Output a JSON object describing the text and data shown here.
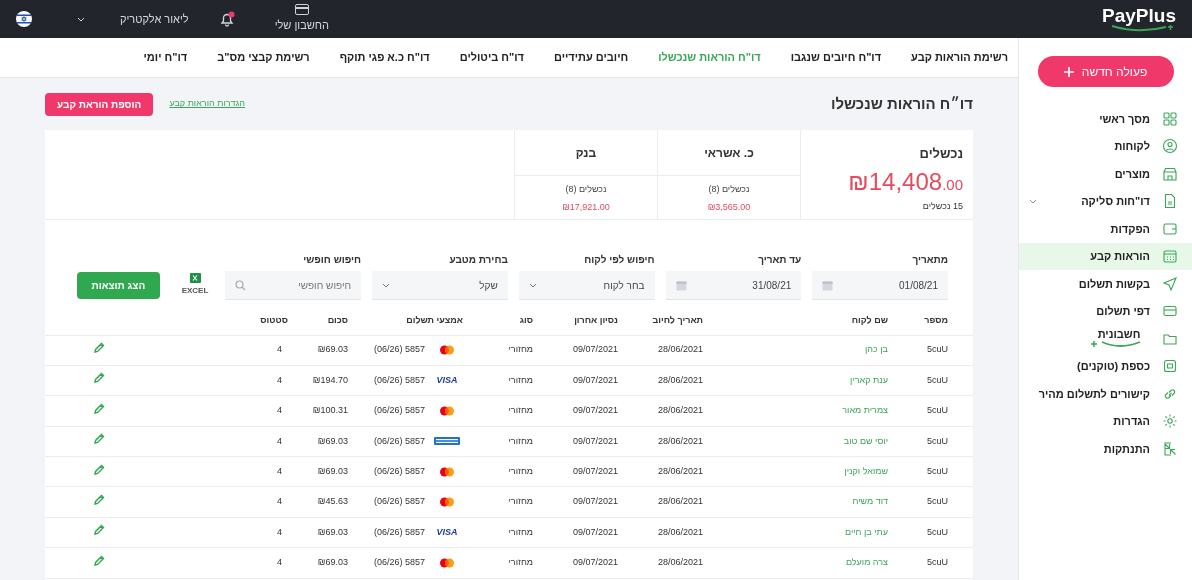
{
  "topbar": {
    "logo": "PayPlus",
    "account": "החשבון שלי",
    "notifications": {
      "unread": true
    },
    "user": "ליאור אלקטריק"
  },
  "sidebar": {
    "new_button": "פעולה חדשה",
    "items": [
      {
        "label": "מסך ראשי",
        "selected": false
      },
      {
        "label": "לקוחות",
        "selected": false
      },
      {
        "label": "מוצרים",
        "selected": false
      },
      {
        "label": "דו\"חות סליקה",
        "selected": false,
        "expandable": true
      },
      {
        "label": "הפקדות",
        "selected": false
      },
      {
        "label": "הוראות קבע",
        "selected": true
      },
      {
        "label": "בקשות תשלום",
        "selected": false
      },
      {
        "label": "דפי תשלום",
        "selected": false
      },
      {
        "label": "חשבונית",
        "selected": false,
        "kind": "logo"
      },
      {
        "label": "כספת (טוקנים)",
        "selected": false
      },
      {
        "label": "קישורים לתשלום מהיר",
        "selected": false
      },
      {
        "label": "הגדרות",
        "selected": false
      },
      {
        "label": "התנתקות",
        "selected": false
      }
    ]
  },
  "tabs": [
    {
      "label": "רשימת הוראות קבע",
      "selected": false
    },
    {
      "label": "דו\"ח חיובים שנגבו",
      "selected": false
    },
    {
      "label": "דו\"ח הוראות שנכשלו",
      "selected": true
    },
    {
      "label": "חיובים עתידיים",
      "selected": false
    },
    {
      "label": "דו\"ח ביטולים",
      "selected": false
    },
    {
      "label": "דו\"ח כ.א פגי תוקף",
      "selected": false
    },
    {
      "label": "רשימת קבצי מס\"ב",
      "selected": false
    },
    {
      "label": "דו\"ח יומי",
      "selected": false
    }
  ],
  "page_title": "דו״ח הוראות שנכשלו",
  "settings_link": "הגדרות הוראות קבע",
  "add_button": "הוספת הוראת קבע",
  "summary": {
    "title": "נכשלים",
    "amount": "₪14,408",
    "decimals": ".00",
    "count": "15 נכשלים",
    "columns": [
      {
        "title": "כ. אשראי",
        "subtitle": "נכשלים (8)",
        "amount": "₪3,565.00"
      },
      {
        "title": "בנק",
        "subtitle": "נכשלים (8)",
        "amount": "₪17,921.00"
      }
    ]
  },
  "filters": [
    {
      "kind": "date",
      "label": "מתאריך",
      "value": "01/08/21"
    },
    {
      "kind": "date",
      "label": "עד תאריך",
      "value": "31/08/21"
    },
    {
      "kind": "select",
      "label": "חיפוש לפי לקוח",
      "value": "בחר לקוח"
    },
    {
      "kind": "select",
      "label": "בחירת מטבע",
      "value": "שקל"
    },
    {
      "kind": "search",
      "label": "חיפוש חופשי",
      "placeholder": "חיפוש חופשי"
    }
  ],
  "excel_label": "EXCEL",
  "show_button": "הצג תוצאות",
  "table": {
    "columns": [
      "מספר",
      "שם לקוח",
      "תאריך לחיוב",
      "נסיון אחרון",
      "סוג",
      "אמצעי תשלום",
      "סכום",
      "סטטוס"
    ],
    "rows": [
      {
        "number": "5cuU",
        "name": "בן כהן",
        "charge_date": "28/06/2021",
        "last_attempt": "09/07/2021",
        "type": "מחזורי",
        "card": {
          "kind": "mastercard"
        },
        "payment": "(06/26) 5857",
        "amount": "₪69.03",
        "status": "4"
      },
      {
        "number": "5cuU",
        "name": "ענת קארין",
        "charge_date": "28/06/2021",
        "last_attempt": "09/07/2021",
        "type": "מחזורי",
        "card": {
          "kind": "visa",
          "mark": "VISA"
        },
        "payment": "(06/26) 5857",
        "amount": "₪194.70",
        "status": "4"
      },
      {
        "number": "5cuU",
        "name": "צמרית מאור",
        "charge_date": "28/06/2021",
        "last_attempt": "09/07/2021",
        "type": "מחזורי",
        "card": {
          "kind": "mastercard"
        },
        "payment": "(06/26) 5857",
        "amount": "₪100.31",
        "status": "4"
      },
      {
        "number": "5cuU",
        "name": "יוסי שם טוב",
        "charge_date": "28/06/2021",
        "last_attempt": "09/07/2021",
        "type": "מחזורי",
        "card": {
          "kind": "amex"
        },
        "payment": "(06/26) 5857",
        "amount": "₪69.03",
        "status": "4"
      },
      {
        "number": "5cuU",
        "name": "שמואל וקנין",
        "charge_date": "28/06/2021",
        "last_attempt": "09/07/2021",
        "type": "מחזורי",
        "card": {
          "kind": "mastercard"
        },
        "payment": "(06/26) 5857",
        "amount": "₪69.03",
        "status": "4"
      },
      {
        "number": "5cuU",
        "name": "דוד משיח",
        "charge_date": "28/06/2021",
        "last_attempt": "09/07/2021",
        "type": "מחזורי",
        "card": {
          "kind": "mastercard"
        },
        "payment": "(06/26) 5857",
        "amount": "₪45.63",
        "status": "4"
      },
      {
        "number": "5cuU",
        "name": "עתי בן חיים",
        "charge_date": "28/06/2021",
        "last_attempt": "09/07/2021",
        "type": "מחזורי",
        "card": {
          "kind": "visa",
          "mark": "VISA"
        },
        "payment": "(06/26) 5857",
        "amount": "₪69.03",
        "status": "4"
      },
      {
        "number": "5cuU",
        "name": "צרה מועלם",
        "charge_date": "28/06/2021",
        "last_attempt": "09/07/2021",
        "type": "מחזורי",
        "card": {
          "kind": "mastercard"
        },
        "payment": "(06/26) 5857",
        "amount": "₪69.03",
        "status": "4"
      }
    ]
  }
}
